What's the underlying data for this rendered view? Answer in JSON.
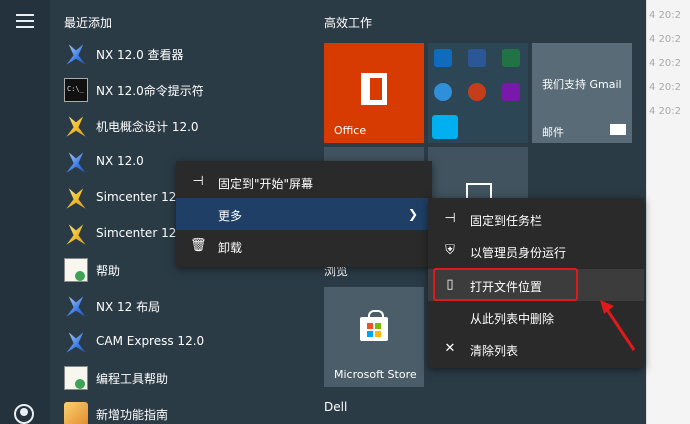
{
  "recent_title": "最近添加",
  "apps": [
    {
      "label": "NX 12.0 查看器",
      "icon": "nx-icon"
    },
    {
      "label": "NX 12.0命令提示符",
      "icon": "cmd-icon"
    },
    {
      "label": "机电概念设计 12.0",
      "icon": "nx-icon"
    },
    {
      "label": "NX 12.0",
      "icon": "nx-icon"
    },
    {
      "label": "Simcenter 12.0",
      "icon": "nx-icon"
    },
    {
      "label": "Simcenter 12.0",
      "icon": "nx-icon"
    },
    {
      "label": "帮助",
      "icon": "help-icon"
    },
    {
      "label": "NX 12 布局",
      "icon": "nx-icon"
    },
    {
      "label": "CAM Express 12.0",
      "icon": "nx-icon"
    },
    {
      "label": "编程工具帮助",
      "icon": "help-icon"
    },
    {
      "label": "新增功能指南",
      "icon": "book-icon"
    }
  ],
  "tiles": {
    "group1_title": "高效工作",
    "office_label": "Office",
    "gmail_label": "我们支持 Gmail",
    "mail_label": "邮件",
    "group2_title": "浏览",
    "store_label": "Microsoft Store",
    "dell_label": "Dell"
  },
  "context_menu": {
    "pin_start": "固定到\"开始\"屏幕",
    "more": "更多",
    "uninstall": "卸载"
  },
  "submenu": {
    "pin_taskbar": "固定到任务栏",
    "run_as_admin": "以管理员身份运行",
    "open_file_location": "打开文件位置",
    "remove_from_list": "从此列表中删除",
    "clear_list": "清除列表"
  },
  "timestamps": [
    "4 20:2",
    "4 20:2",
    "4 20:2",
    "4 20:2",
    "4 20:2"
  ],
  "colors": {
    "office": "#d83b01",
    "active_menu": "#1f3f66",
    "highlight": "#e01a1a"
  }
}
